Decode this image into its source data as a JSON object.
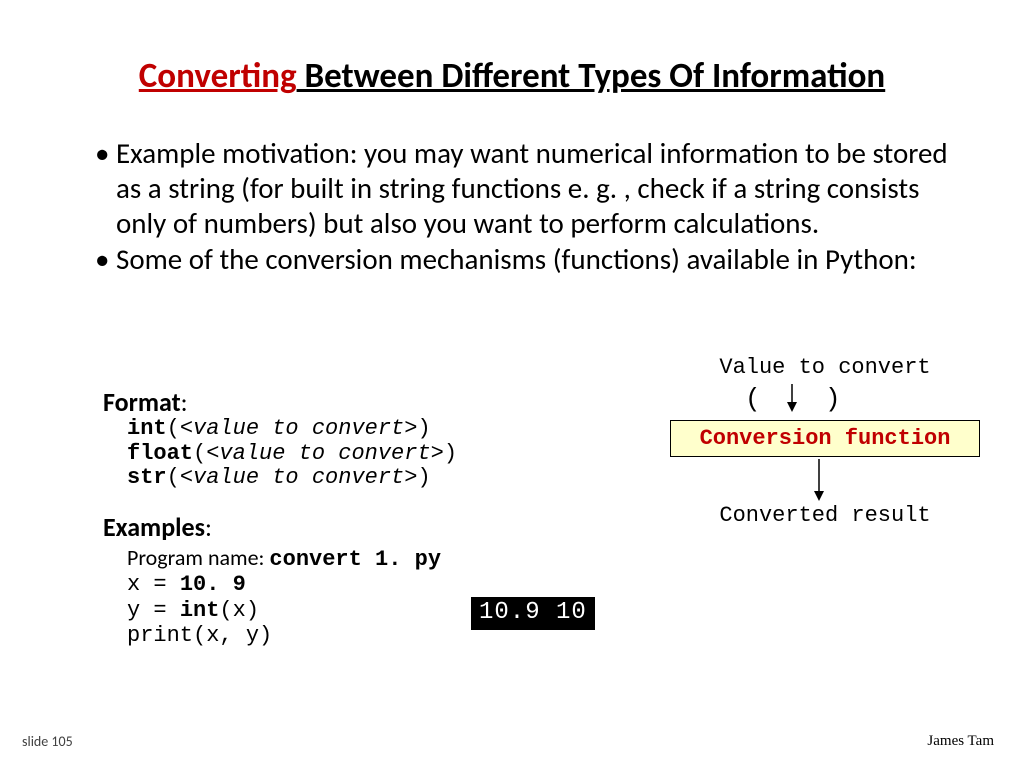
{
  "title": {
    "red": "Converting",
    "rest": " Between Different Types Of Information"
  },
  "bullets": {
    "b1": "Example motivation: you may want numerical information to be stored as a string (for built in string functions e. g. , check if a string consists only of numbers) but also you want to perform calculations.",
    "b2": "Some of the conversion mechanisms (functions) available in Python:"
  },
  "format": {
    "label": "Format",
    "colon": ":",
    "lines": {
      "l1": {
        "kw": "int",
        "p1": "(",
        "arg": "<value to convert>",
        "p2": ")"
      },
      "l2": {
        "kw": "float",
        "p1": "(",
        "arg": "<value to convert>",
        "p2": ")"
      },
      "l3": {
        "kw": "str",
        "p1": "(",
        "arg": "<value to convert>",
        "p2": ")"
      }
    }
  },
  "examples": {
    "label": "Examples",
    "colon": ":",
    "progname_label": "Program name: ",
    "progname": "convert 1. py",
    "l1": {
      "a": "x = ",
      "b": "10. 9"
    },
    "l2": {
      "a": "y = ",
      "b": "int",
      "c": "(x)"
    },
    "l3": "print(x, y)"
  },
  "output": "10.9 10",
  "diagram": {
    "value_label": "Value to convert",
    "paren_l": "(",
    "paren_r": ")",
    "func_label": "Conversion function",
    "result_label": "Converted result"
  },
  "footer": {
    "slide": "slide 105",
    "author": "James Tam"
  }
}
